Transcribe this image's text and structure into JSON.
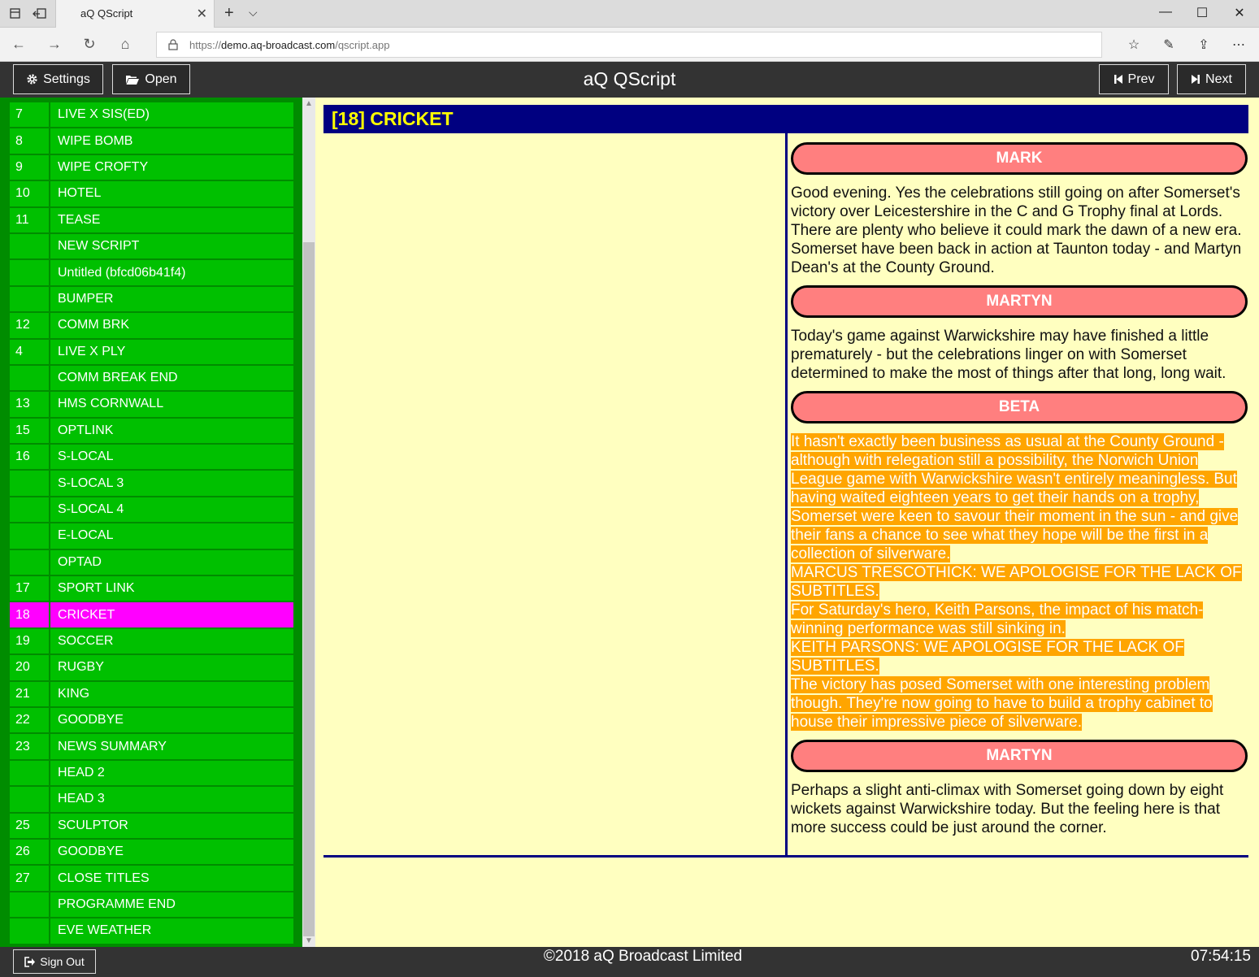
{
  "browser": {
    "tab_title": "aQ QScript",
    "tab_close": "✕",
    "new_tab": "+",
    "tab_list": "⌵",
    "url_prefix": "https://",
    "url_host": "demo.aq-broadcast.com",
    "url_path": "/qscript.app",
    "minimize": "—",
    "maximize": "☐",
    "close": "✕",
    "back": "←",
    "forward": "→",
    "refresh": "↻",
    "home": "⌂",
    "favorites": "☆",
    "notes": "✎",
    "share": "⇪",
    "more": "⋯"
  },
  "header": {
    "title": "aQ QScript",
    "settings_label": "Settings",
    "open_label": "Open",
    "prev_label": "Prev",
    "next_label": "Next"
  },
  "sidebar": {
    "items": [
      {
        "num": "7",
        "label": "LIVE X SIS(ED)"
      },
      {
        "num": "8",
        "label": "WIPE BOMB"
      },
      {
        "num": "9",
        "label": "WIPE CROFTY"
      },
      {
        "num": "10",
        "label": "HOTEL"
      },
      {
        "num": "11",
        "label": "TEASE"
      },
      {
        "num": "",
        "label": "NEW SCRIPT"
      },
      {
        "num": "",
        "label": "Untitled (bfcd06b41f4)"
      },
      {
        "num": "",
        "label": "BUMPER"
      },
      {
        "num": "12",
        "label": "COMM BRK"
      },
      {
        "num": "4",
        "label": "LIVE X PLY"
      },
      {
        "num": "",
        "label": "COMM BREAK END"
      },
      {
        "num": "13",
        "label": "HMS CORNWALL"
      },
      {
        "num": "15",
        "label": "OPTLINK"
      },
      {
        "num": "16",
        "label": "S-LOCAL"
      },
      {
        "num": "",
        "label": "S-LOCAL 3"
      },
      {
        "num": "",
        "label": "S-LOCAL 4"
      },
      {
        "num": "",
        "label": "E-LOCAL"
      },
      {
        "num": "",
        "label": "OPTAD"
      },
      {
        "num": "17",
        "label": "SPORT LINK"
      },
      {
        "num": "18",
        "label": "CRICKET",
        "active": true
      },
      {
        "num": "19",
        "label": "SOCCER"
      },
      {
        "num": "20",
        "label": "RUGBY"
      },
      {
        "num": "21",
        "label": "KING"
      },
      {
        "num": "22",
        "label": "GOODBYE"
      },
      {
        "num": "23",
        "label": "NEWS SUMMARY"
      },
      {
        "num": "",
        "label": "HEAD 2"
      },
      {
        "num": "",
        "label": "HEAD 3"
      },
      {
        "num": "25",
        "label": "SCULPTOR"
      },
      {
        "num": "26",
        "label": "GOODBYE"
      },
      {
        "num": "27",
        "label": "CLOSE TITLES"
      },
      {
        "num": "",
        "label": "PROGRAMME END"
      },
      {
        "num": "",
        "label": "EVE WEATHER"
      }
    ]
  },
  "story": {
    "title": "[18] CRICKET",
    "blocks": [
      {
        "presenter": "MARK",
        "lines": [
          "Good evening. Yes the celebrations still going on after Somerset's victory over Leicestershire in the C and G Trophy final at Lords. There are plenty who believe it could mark the dawn of a new era. Somerset have been back in action at Taunton today - and Martyn Dean's at the County Ground."
        ],
        "highlight": false
      },
      {
        "presenter": "MARTYN",
        "lines": [
          "Today's game against Warwickshire may have finished a little prematurely - but the celebrations linger on with Somerset determined to make the most of things after that long, long wait."
        ],
        "highlight": false
      },
      {
        "presenter": "BETA",
        "lines": [
          "It hasn't exactly been business as usual at the County Ground - although with relegation still a possibility, the Norwich Union League game with Warwickshire wasn't entirely meaningless. But having waited eighteen years to get their hands on a trophy, Somerset were keen to savour their moment in the sun - and give their fans a chance to see what they hope will be the first in a collection of silverware.",
          "MARCUS TRESCOTHICK: WE APOLOGISE FOR THE LACK OF SUBTITLES.",
          "For Saturday's hero, Keith Parsons, the impact of his match-winning performance was still sinking in.",
          "KEITH PARSONS: WE APOLOGISE FOR THE LACK OF SUBTITLES.",
          "The victory has posed Somerset with one interesting problem though. They're now going to have to build a trophy cabinet to house their impressive piece of silverware."
        ],
        "highlight": true
      },
      {
        "presenter": "MARTYN",
        "lines": [
          "Perhaps a slight anti-climax with Somerset going down by eight wickets against Warwickshire today. But the feeling here is that more success could be just around the corner."
        ],
        "highlight": false
      }
    ]
  },
  "footer": {
    "signout_label": "Sign Out",
    "copyright": "©2018 aQ Broadcast Limited",
    "clock": "07:54:15"
  },
  "colors": {
    "header_bg": "#333333",
    "sidebar_item": "#00c000",
    "sidebar_active": "#ff00ff",
    "story_title_bg": "#000080",
    "story_title_text": "#ffff00",
    "page_bg": "#ffffc0",
    "presenter_bg": "#ff7f7f",
    "highlight_bg": "#ffa500"
  }
}
